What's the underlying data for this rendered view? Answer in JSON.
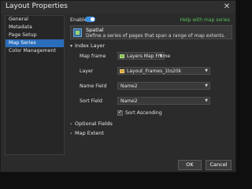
{
  "window": {
    "title": "Layout Properties",
    "close_glyph": "✕"
  },
  "sidebar": {
    "items": [
      {
        "label": "General"
      },
      {
        "label": "Metadata"
      },
      {
        "label": "Page Setup"
      },
      {
        "label": "Map Series",
        "active": true
      },
      {
        "label": "Color Management"
      }
    ]
  },
  "content": {
    "enable_label": "Enable",
    "enable_on": true,
    "help_link": "Help with map series",
    "series_type": {
      "name": "Spatial",
      "description": "Define a series of pages that span a range of map extents.",
      "icon": "spatial-series-icon"
    },
    "index_layer": {
      "section_label": "Index Layer",
      "expanded": true,
      "map_frame": {
        "label": "Map frame",
        "value": "Layers Map Frame",
        "icon": "map-frame-icon"
      },
      "layer": {
        "label": "Layer",
        "value": "Layout_Frames_1to20k",
        "icon": "layer-icon"
      },
      "name_field": {
        "label": "Name Field",
        "value": "Name2"
      },
      "sort_field": {
        "label": "Sort Field",
        "value": "Name2"
      },
      "sort_ascending": {
        "label": "Sort Ascending",
        "checked": true
      }
    },
    "optional_fields": {
      "section_label": "Optional Fields",
      "expanded": false
    },
    "map_extent": {
      "section_label": "Map Extent",
      "expanded": false
    }
  },
  "footer": {
    "ok_label": "OK",
    "cancel_label": "Cancel"
  },
  "colors": {
    "accent": "#2a6ebb",
    "toggle": "#3b8fe0",
    "help_link": "#56c05a",
    "background": "#2b2b2b"
  }
}
